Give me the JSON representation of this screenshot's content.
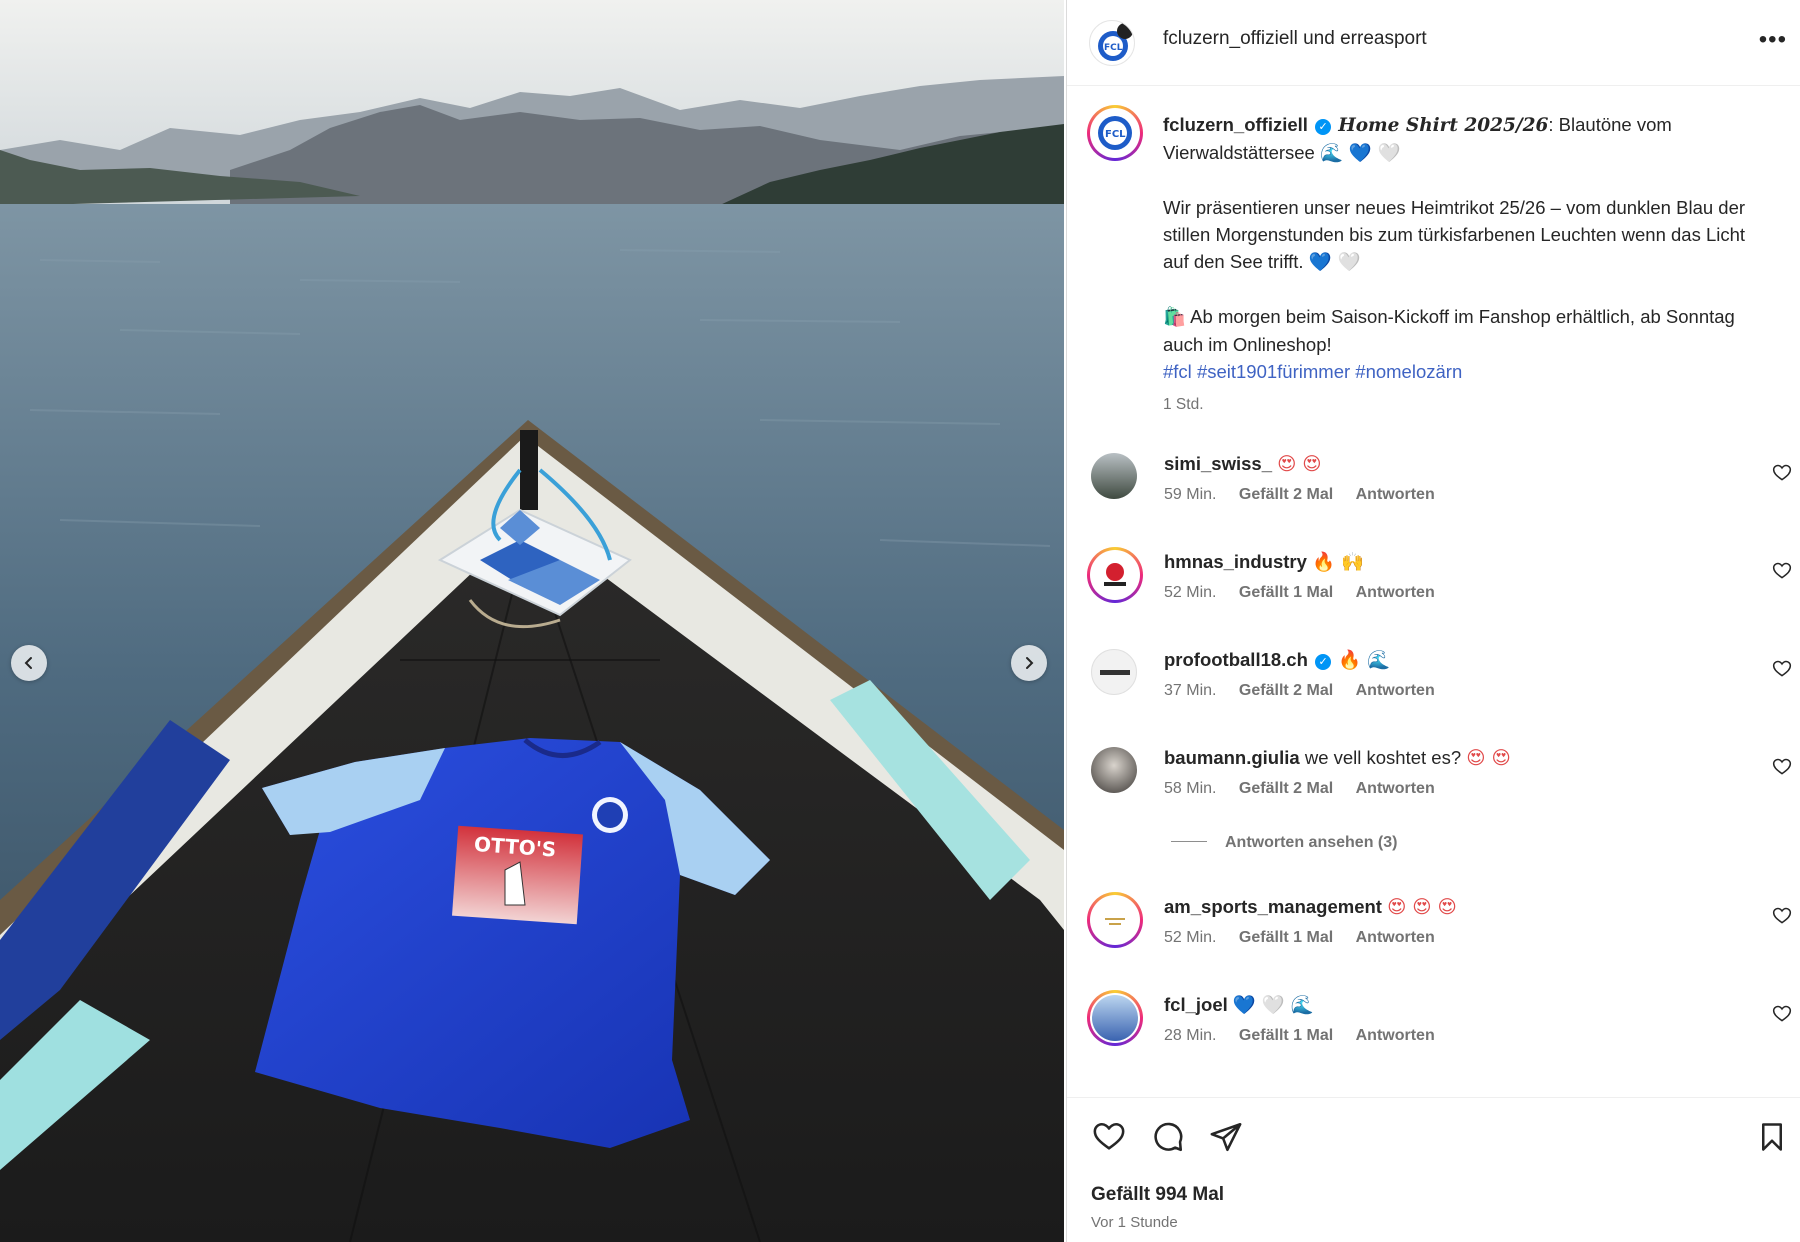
{
  "header": {
    "author": "fcluzern_offiziell",
    "connector": "und",
    "coauthor": "erreasport",
    "more_icon": "more-options-icon"
  },
  "caption": {
    "author": "fcluzern_offiziell",
    "title": "Home Shirt 2025/26",
    "line1_rest": ": Blautöne vom Vierwaldstättersee",
    "line1_emoji": "🌊 💙 🤍",
    "para2": "Wir präsentieren unser neues Heimtrikot 25/26 – vom dunklen Blau der stillen Morgenstunden bis zum türkisfarbenen Leuchten wenn das Licht auf den See trifft.",
    "para2_emoji": "💙 🤍",
    "para3_emoji": "🛍️",
    "para3": "Ab morgen beim Saison-Kickoff im Fanshop erhältlich, ab Sonntag auch im Onlineshop!",
    "hashtags": [
      "#fcl",
      "#seit1901fürimmer",
      "#nomelozärn"
    ],
    "time": "1 Std."
  },
  "comments": [
    {
      "user": "simi_swiss_",
      "text": "",
      "emoji": "😍 😍",
      "time": "59 Min.",
      "likes": "Gefällt 2 Mal",
      "reply": "Antworten"
    },
    {
      "user": "hmnas_industry",
      "text": "",
      "emoji": "🔥 🙌",
      "time": "52 Min.",
      "likes": "Gefällt 1 Mal",
      "reply": "Antworten"
    },
    {
      "user": "profootball18.ch",
      "text": "",
      "emoji": "🔥 🌊",
      "time": "37 Min.",
      "likes": "Gefällt 2 Mal",
      "reply": "Antworten"
    },
    {
      "user": "baumann.giulia",
      "text": "we vell koshtet es?",
      "emoji": "😍 😍",
      "time": "58 Min.",
      "likes": "Gefällt 2 Mal",
      "reply": "Antworten"
    },
    {
      "user": "am_sports_management",
      "text": "",
      "emoji": "😍 😍 😍",
      "time": "52 Min.",
      "likes": "Gefällt 1 Mal",
      "reply": "Antworten"
    },
    {
      "user": "fcl_joel",
      "text": "",
      "emoji": "💙 🤍 🌊",
      "time": "28 Min.",
      "likes": "Gefällt 1 Mal",
      "reply": "Antworten"
    }
  ],
  "view_replies": "Antworten ansehen (3)",
  "footer": {
    "likes_total": "Gefällt 994 Mal",
    "posted": "Vor 1 Stunde"
  },
  "photo": {
    "sponsor": "OTTO'S"
  },
  "colors": {
    "link": "#3f63c3",
    "verified": "#0095f6",
    "jersey_blue": "#1e3fd0",
    "jersey_sleeve": "#9fc8ee"
  }
}
